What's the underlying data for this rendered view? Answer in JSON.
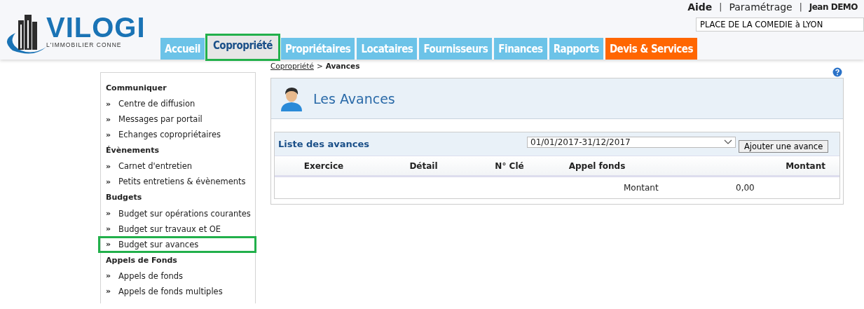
{
  "logo": {
    "name": "VILOGI",
    "tagline": "L'IMMOBILIER CONNE"
  },
  "top_links": [
    {
      "label": "Aide",
      "bold": true
    },
    {
      "label": "Paramétrage",
      "bold": false
    }
  ],
  "separator": "|",
  "user": "Jean DEMO",
  "building_field": {
    "value": "PLACE DE LA COMEDIE à LYON"
  },
  "tabs": [
    {
      "label": "Accueil",
      "selected": false,
      "kind": "normal"
    },
    {
      "label": "Copropriété",
      "selected": true,
      "kind": "normal"
    },
    {
      "label": "Propriétaires",
      "selected": false,
      "kind": "normal"
    },
    {
      "label": "Locataires",
      "selected": false,
      "kind": "normal"
    },
    {
      "label": "Fournisseurs",
      "selected": false,
      "kind": "normal"
    },
    {
      "label": "Finances",
      "selected": false,
      "kind": "normal"
    },
    {
      "label": "Rapports",
      "selected": false,
      "kind": "normal"
    },
    {
      "label": "Devis & Services",
      "selected": false,
      "kind": "highlight"
    }
  ],
  "sidebar": {
    "sections": [
      {
        "title": "Communiquer",
        "items": [
          {
            "label": "Centre de diffusion",
            "selected": false
          },
          {
            "label": "Messages par portail",
            "selected": false
          },
          {
            "label": "Echanges copropriétaires",
            "selected": false
          }
        ]
      },
      {
        "title": "Évènements",
        "items": [
          {
            "label": "Carnet d'entretien",
            "selected": false
          },
          {
            "label": "Petits entretiens & évènements",
            "selected": false
          }
        ]
      },
      {
        "title": "Budgets",
        "items": [
          {
            "label": "Budget sur opérations courantes",
            "selected": false
          },
          {
            "label": "Budget sur travaux et OE",
            "selected": false
          },
          {
            "label": "Budget sur avances",
            "selected": true
          }
        ]
      },
      {
        "title": "Appels de Fonds",
        "items": [
          {
            "label": "Appels de fonds",
            "selected": false
          },
          {
            "label": "Appels de fonds multiples",
            "selected": false
          }
        ]
      }
    ],
    "bullet": "»"
  },
  "breadcrumb": {
    "link": "Copropriété",
    "separator": ">",
    "current": "Avances"
  },
  "page_title": "Les Avances",
  "list": {
    "title": "Liste des avances",
    "period_select": {
      "value": "01/01/2017-31/12/2017"
    },
    "add_button": "Ajouter une avance",
    "columns": [
      "Exercice",
      "Détail",
      "N° Clé",
      "Appel fonds",
      "Montant"
    ],
    "total_row": {
      "label": "Montant",
      "value": "0,00"
    }
  }
}
